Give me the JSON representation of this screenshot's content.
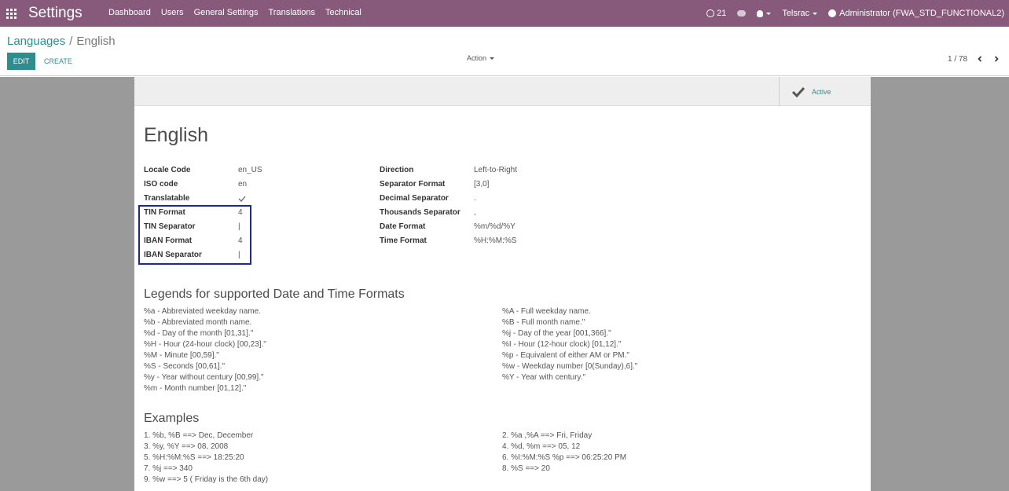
{
  "navbar": {
    "brand": "Settings",
    "menu": [
      "Dashboard",
      "Users",
      "General Settings",
      "Translations",
      "Technical"
    ],
    "notification_count": "21",
    "company": "Telsrac",
    "user": "Administrator (FWA_STD_FUNCTIONAL2)"
  },
  "breadcrumb": {
    "parent": "Languages",
    "separator": "/",
    "current": "English"
  },
  "buttons": {
    "edit": "EDIT",
    "create": "CREATE",
    "action": "Action"
  },
  "pager": {
    "value": "1 / 78"
  },
  "status": {
    "active_label": "Active"
  },
  "record": {
    "title": "English",
    "left_fields": [
      {
        "label": "Locale Code",
        "value": "en_US"
      },
      {
        "label": "ISO code",
        "value": "en"
      },
      {
        "label": "Translatable",
        "value": ""
      },
      {
        "label": "TIN Format",
        "value": "4"
      },
      {
        "label": "TIN Separator",
        "value": "|"
      },
      {
        "label": "IBAN Format",
        "value": "4"
      },
      {
        "label": "IBAN Separator",
        "value": "|"
      }
    ],
    "right_fields": [
      {
        "label": "Direction",
        "value": "Left-to-Right"
      },
      {
        "label": "Separator Format",
        "value": "[3,0]"
      },
      {
        "label": "Decimal Separator",
        "value": "."
      },
      {
        "label": "Thousands Separator",
        "value": ","
      },
      {
        "label": "Date Format",
        "value": "%m/%d/%Y"
      },
      {
        "label": "Time Format",
        "value": "%H:%M:%S"
      }
    ]
  },
  "legends": {
    "title": "Legends for supported Date and Time Formats",
    "left": [
      "%a - Abbreviated weekday name.",
      "%b - Abbreviated month name.",
      "%d - Day of the month [01,31].\"",
      "%H - Hour (24-hour clock) [00,23].\"",
      "%M - Minute [00,59].\"",
      "%S - Seconds [00,61].\"",
      "%y - Year without century [00,99].\"",
      "%m - Month number [01,12].\""
    ],
    "right": [
      "%A - Full weekday name.",
      "%B - Full month name.\"",
      "%j - Day of the year [001,366].\"",
      "%I - Hour (12-hour clock) [01,12].\"",
      "%p - Equivalent of either AM or PM.\"",
      "%w - Weekday number [0(Sunday),6].\"",
      "%Y - Year with century.\""
    ]
  },
  "examples": {
    "title": "Examples",
    "left": [
      "1. %b, %B ==> Dec, December",
      "3. %y, %Y ==> 08, 2008",
      "5. %H:%M:%S ==> 18:25:20",
      "7. %j ==> 340",
      "9. %w ==> 5 ( Friday is the 6th day)"
    ],
    "right": [
      "2. %a ,%A ==> Fri, Friday",
      "4. %d, %m ==> 05, 12",
      "6. %I:%M:%S %p ==> 06:25:20 PM",
      "8. %S ==> 20"
    ]
  }
}
